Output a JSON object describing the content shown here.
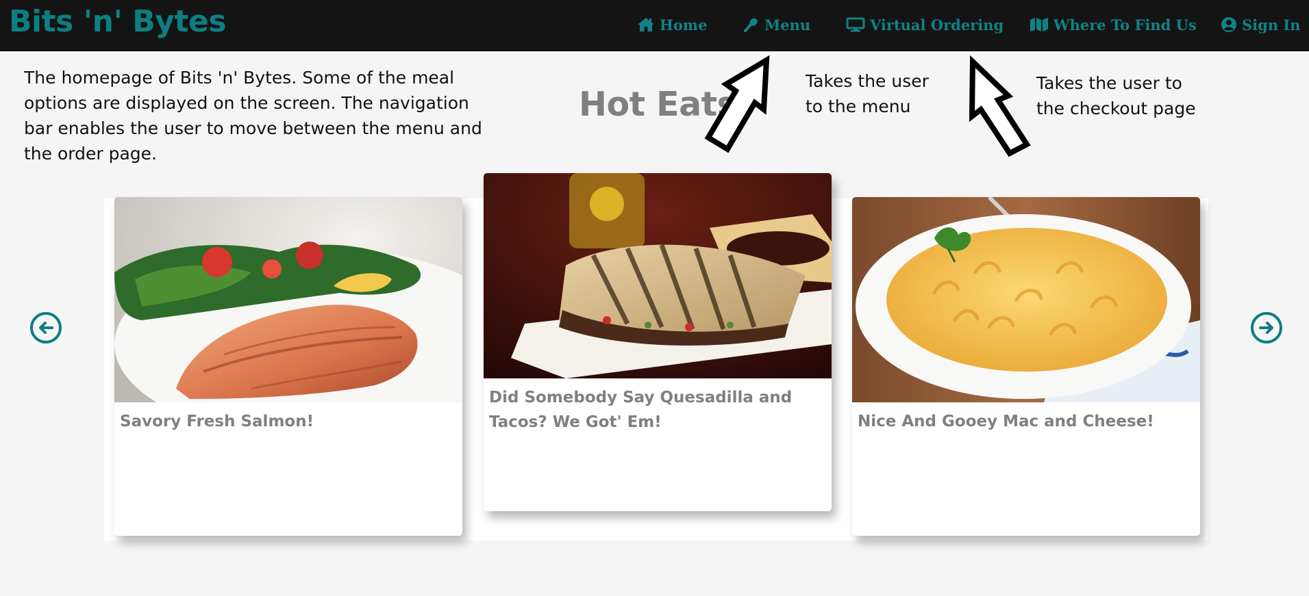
{
  "brand": "Bits 'n' Bytes",
  "nav": {
    "home": "Home",
    "menu": "Menu",
    "virtual_ordering": "Virtual Ordering",
    "where_to_find_us": "Where To Find Us",
    "sign_in": "Sign In"
  },
  "annotations": {
    "intro": "The homepage of Bits 'n' Bytes. Some of the meal options are displayed on the screen. The navigation bar enables the user to move between the menu and the order page.",
    "menu_line1": "Takes the user",
    "menu_line2": "to the menu",
    "checkout_line1": "Takes the user to",
    "checkout_line2": "the checkout page"
  },
  "hero_title": "Hot Eats!",
  "cards": [
    {
      "title": "Savory Fresh Salmon!",
      "image": "salmon-with-salad-photo"
    },
    {
      "title": "Did Somebody Say Quesadilla and Tacos? We Got' Em!",
      "image": "quesadilla-photo"
    },
    {
      "title": "Nice And Gooey Mac and Cheese!",
      "image": "mac-and-cheese-photo"
    }
  ],
  "icons": {
    "home": "house-icon",
    "menu": "utensil-icon",
    "virtual_ordering": "monitor-icon",
    "where_to_find_us": "map-icon",
    "sign_in": "user-circle-icon",
    "prev": "arrow-circle-left-icon",
    "next": "arrow-circle-right-icon"
  },
  "colors": {
    "accent": "#0c7f82",
    "navbar": "#141414",
    "title_gray": "#808080",
    "page_bg": "#f5f5f5"
  }
}
